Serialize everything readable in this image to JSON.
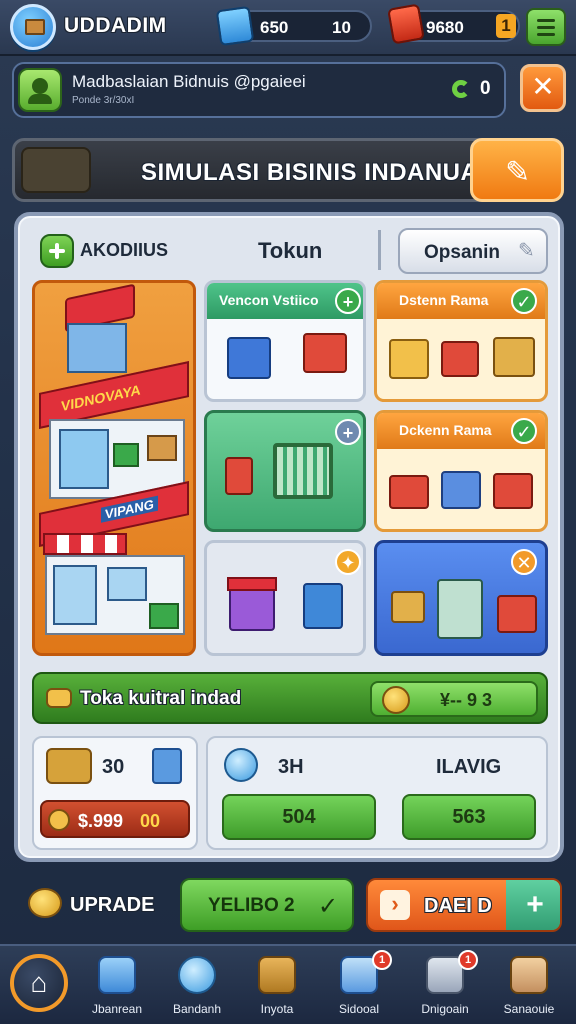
{
  "header": {
    "title": "UDDADIM",
    "stats": [
      {
        "icon": "cash-stack-icon",
        "value": "650",
        "level": "10"
      },
      {
        "icon": "gift-box-icon",
        "value": "9680",
        "level": "1"
      }
    ]
  },
  "notification": {
    "title": "Madbaslaian Bidnuis @pgaieei",
    "subtitle": "Ponde 3r/30xI",
    "count": "0"
  },
  "banner": {
    "title": "SIMULASI BISINIS INDANUA"
  },
  "panel": {
    "left_label": "AKODIIUS",
    "center_label": "Tokun",
    "option_label": "Opsanin"
  },
  "store": {
    "sign_top": "VIDNOVAYA",
    "sign_bottom": "VIPANG"
  },
  "cards": {
    "c1_title": "Vencon Vstiico",
    "c2_title": "Dstenn Rama",
    "c3_title": "Dckenn Rama"
  },
  "goal": {
    "label": "Toka kuitral indad",
    "value": "¥-- 9 3"
  },
  "cash": {
    "value": "30",
    "amount": "$.999",
    "amount_suffix": "00"
  },
  "stats_card": {
    "left_value": "3H",
    "right_label": "ILAVIG",
    "btn1": "504",
    "btn2": "563"
  },
  "actions": {
    "upgrade_label": "UPRADE",
    "upgrade_btn": "YELIBO 2",
    "deal_btn": "DAEI D"
  },
  "nav": [
    {
      "label": "Jbanrean",
      "icon": "store-icon",
      "badge": ""
    },
    {
      "label": "Bandanh",
      "icon": "chart-icon",
      "badge": ""
    },
    {
      "label": "Inyota",
      "icon": "crate-icon",
      "badge": ""
    },
    {
      "label": "Sidooal",
      "icon": "calendar-icon",
      "badge": "1"
    },
    {
      "label": "Dnigoain",
      "icon": "ledger-icon",
      "badge": "1"
    },
    {
      "label": "Sanaouie",
      "icon": "manager-icon",
      "badge": ""
    }
  ],
  "colors": {
    "accent_orange": "#f07a12",
    "accent_green": "#3e9e26",
    "panel_bg": "#dfe5ee"
  }
}
